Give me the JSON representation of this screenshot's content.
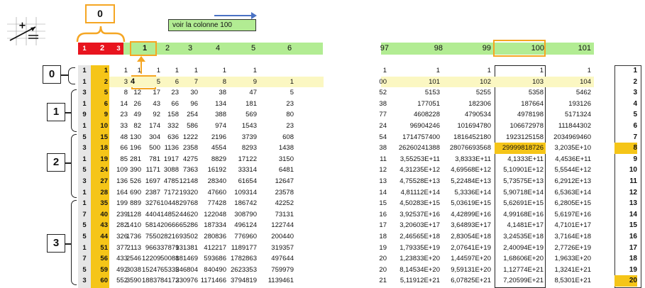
{
  "annotation": {
    "zero_label": "0",
    "scroll_hint": "voir la colonne 100"
  },
  "left_header": {
    "red_cols": [
      "1",
      "2",
      "3"
    ],
    "green_cols": [
      "1",
      "2",
      "3",
      "4",
      "5",
      "6"
    ]
  },
  "right_header": {
    "cols": [
      "97",
      "98",
      "99",
      "100",
      "101"
    ]
  },
  "groups": [
    "0",
    "1",
    "2",
    "3"
  ],
  "row_index": {
    "a": [
      "1",
      "1",
      "3",
      "1",
      "9",
      "1",
      "5",
      "3",
      "1",
      "5",
      "3",
      "1",
      "1",
      "7",
      "5",
      "5",
      "1",
      "7",
      "5",
      "3",
      "1"
    ],
    "b": [
      "1",
      "2",
      "5",
      "6",
      "9",
      "10",
      "15",
      "18",
      "19",
      "24",
      "27",
      "28",
      "35",
      "40",
      "43",
      "44",
      "51",
      "56",
      "59",
      "60"
    ]
  },
  "left_rows": [
    [
      "1",
      "1",
      "1",
      "1",
      "1",
      "1",
      "1"
    ],
    [
      "3",
      "4",
      "5",
      "6",
      "7",
      "8",
      "9",
      "1"
    ],
    [
      "8",
      "12",
      "17",
      "23",
      "30",
      "38",
      "47",
      "5"
    ],
    [
      "14",
      "26",
      "43",
      "66",
      "96",
      "134",
      "181",
      "23"
    ],
    [
      "23",
      "49",
      "92",
      "158",
      "254",
      "388",
      "569",
      "80"
    ],
    [
      "33",
      "82",
      "174",
      "332",
      "586",
      "974",
      "1543",
      "23"
    ],
    [
      "48",
      "130",
      "304",
      "636",
      "1222",
      "2196",
      "3739",
      "608"
    ],
    [
      "66",
      "196",
      "500",
      "1136",
      "2358",
      "4554",
      "8293",
      "1438"
    ],
    [
      "85",
      "281",
      "781",
      "1917",
      "4275",
      "8829",
      "17122",
      "3150"
    ],
    [
      "109",
      "390",
      "1171",
      "3088",
      "7363",
      "16192",
      "33314",
      "6481"
    ],
    [
      "136",
      "526",
      "1697",
      "4785",
      "12148",
      "28340",
      "61654",
      "12647"
    ],
    [
      "164",
      "690",
      "2387",
      "7172",
      "19320",
      "47660",
      "109314",
      "23578"
    ],
    [
      "199",
      "889",
      "3276",
      "10448",
      "29768",
      "77428",
      "186742",
      "42252"
    ],
    [
      "239",
      "1128",
      "4404",
      "14852",
      "44620",
      "122048",
      "308790",
      "73131"
    ],
    [
      "282",
      "1410",
      "5814",
      "20666",
      "65286",
      "187334",
      "496124",
      "122744"
    ],
    [
      "326",
      "1736",
      "7550",
      "28216",
      "93502",
      "280836",
      "776960",
      "200440"
    ],
    [
      "377",
      "2113",
      "9663",
      "37879",
      "131381",
      "412217",
      "1189177",
      "319357"
    ],
    [
      "433",
      "2546",
      "12209",
      "50088",
      "181469",
      "593686",
      "1782863",
      "497644"
    ],
    [
      "492",
      "3038",
      "15247",
      "65335",
      "246804",
      "840490",
      "2623353",
      "759979"
    ],
    [
      "552",
      "3590",
      "18837",
      "84172",
      "330976",
      "1171466",
      "3794819",
      "1139461"
    ]
  ],
  "right_rows": [
    [
      "1",
      "1",
      "1",
      "1",
      "1"
    ],
    [
      "00",
      "101",
      "102",
      "103",
      "104"
    ],
    [
      "52",
      "5153",
      "5255",
      "5358",
      "5462"
    ],
    [
      "38",
      "177051",
      "182306",
      "187664",
      "193126"
    ],
    [
      "77",
      "4608228",
      "4790534",
      "4978198",
      "5171324"
    ],
    [
      "24",
      "96904246",
      "101694780",
      "106672978",
      "111844302"
    ],
    [
      "54",
      "1714757400",
      "1816452180",
      "1923125158",
      "2034969460"
    ],
    [
      "38",
      "26260241388",
      "28076693568",
      "29999818726",
      "3,2035E+10"
    ],
    [
      "11",
      "3,55253E+11",
      "3,8333E+11",
      "4,1333E+11",
      "4,4536E+11"
    ],
    [
      "12",
      "4,31235E+12",
      "4,69568E+12",
      "5,10901E+12",
      "5,5544E+12"
    ],
    [
      "13",
      "4,75528E+13",
      "5,22484E+13",
      "5,73575E+13",
      "6,2912E+13"
    ],
    [
      "14",
      "4,81112E+14",
      "5,3336E+14",
      "5,90718E+14",
      "6,5363E+14"
    ],
    [
      "15",
      "4,50283E+15",
      "5,03619E+15",
      "5,62691E+15",
      "6,2805E+15"
    ],
    [
      "16",
      "3,92537E+16",
      "4,42899E+16",
      "4,99168E+16",
      "5,6197E+16"
    ],
    [
      "17",
      "3,20603E+17",
      "3,64893E+17",
      "4,1481E+17",
      "4,7101E+17"
    ],
    [
      "18",
      "2,46565E+18",
      "2,83054E+18",
      "3,24535E+18",
      "3,7164E+18"
    ],
    [
      "19",
      "1,79335E+19",
      "2,07641E+19",
      "2,40094E+19",
      "2,7726E+19"
    ],
    [
      "20",
      "1,23833E+20",
      "1,44597E+20",
      "1,68606E+20",
      "1,9633E+20"
    ],
    [
      "20",
      "8,14534E+20",
      "9,59131E+20",
      "1,12774E+21",
      "1,3241E+21"
    ],
    [
      "21",
      "5,11912E+21",
      "6,07825E+21",
      "7,20599E+21",
      "8,5301E+21"
    ]
  ],
  "far_right": [
    "1",
    "2",
    "3",
    "4",
    "5",
    "6",
    "7",
    "8",
    "9",
    "10",
    "11",
    "12",
    "13",
    "14",
    "15",
    "16",
    "17",
    "18",
    "19",
    "20"
  ]
}
